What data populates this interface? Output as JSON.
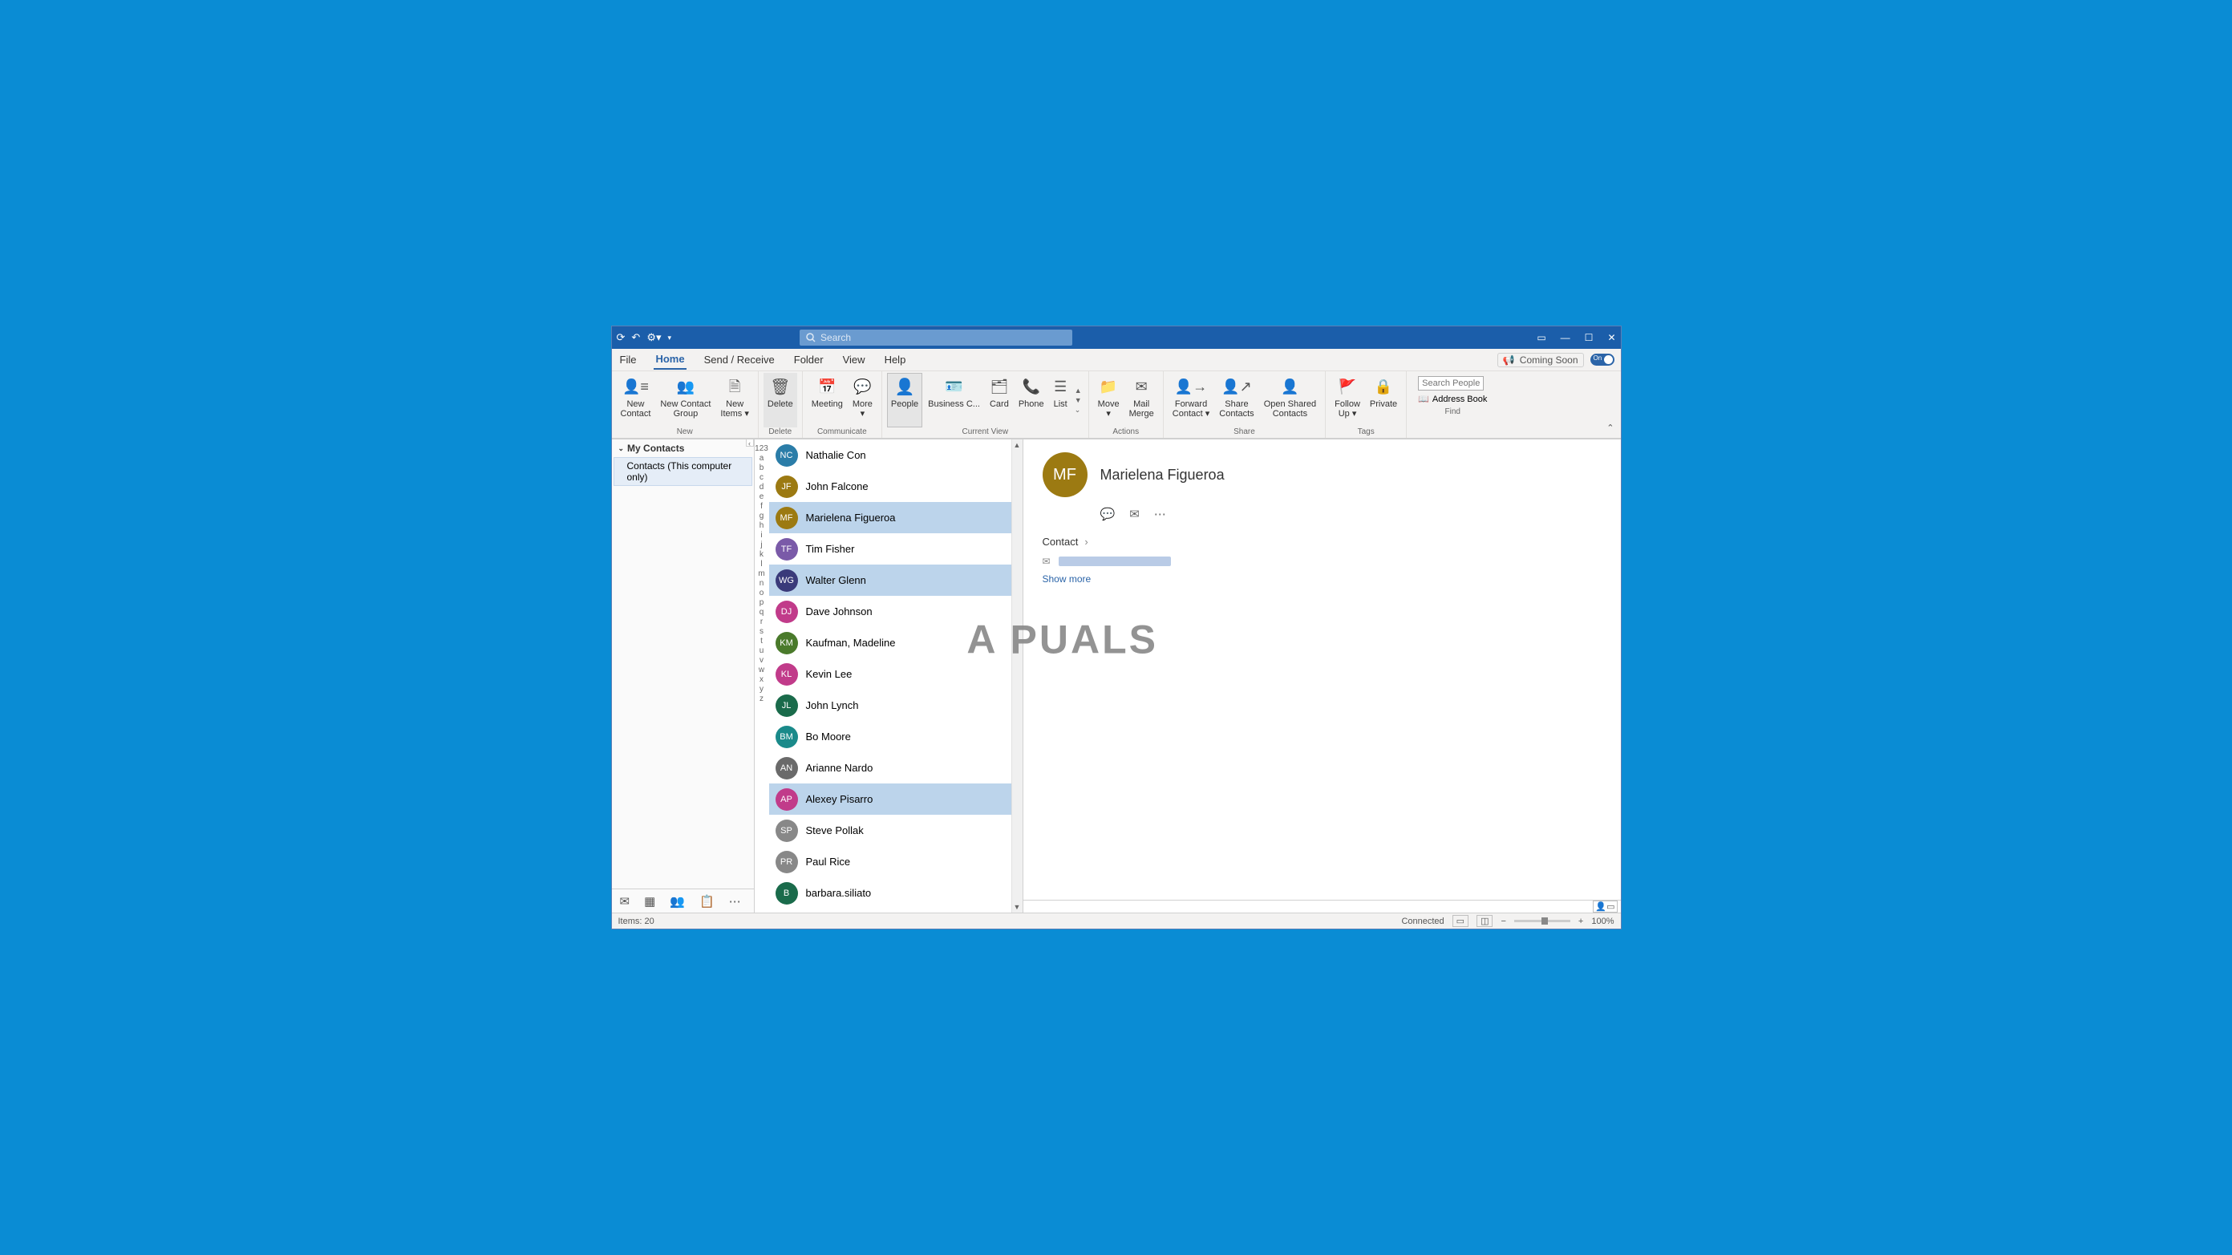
{
  "titlebar": {
    "search_placeholder": "Search"
  },
  "menubar": {
    "tabs": [
      "File",
      "Home",
      "Send / Receive",
      "Folder",
      "View",
      "Help"
    ],
    "active": "Home",
    "coming_soon": "Coming Soon",
    "toggle_state": "On"
  },
  "ribbon": {
    "groups": {
      "new": {
        "label": "New",
        "items": [
          {
            "label": "New\nContact",
            "icon": "person-plus"
          },
          {
            "label": "New Contact\nGroup",
            "icon": "people"
          },
          {
            "label": "New\nItems ▾",
            "icon": "file"
          }
        ]
      },
      "delete": {
        "label": "Delete",
        "items": [
          {
            "label": "Delete",
            "icon": "trash"
          }
        ]
      },
      "communicate": {
        "label": "Communicate",
        "items": [
          {
            "label": "Meeting",
            "icon": "calendar"
          },
          {
            "label": "More\n▾",
            "icon": "speech"
          }
        ]
      },
      "currentview": {
        "label": "Current View",
        "items": [
          {
            "label": "People",
            "icon": "person",
            "active": true
          },
          {
            "label": "Business C...",
            "icon": "card"
          },
          {
            "label": "Card",
            "icon": "card2"
          },
          {
            "label": "Phone",
            "icon": "phone"
          },
          {
            "label": "List",
            "icon": "list"
          }
        ]
      },
      "actions": {
        "label": "Actions",
        "items": [
          {
            "label": "Move\n▾",
            "icon": "move"
          },
          {
            "label": "Mail\nMerge",
            "icon": "envelope"
          }
        ]
      },
      "share": {
        "label": "Share",
        "items": [
          {
            "label": "Forward\nContact ▾",
            "icon": "forward"
          },
          {
            "label": "Share\nContacts",
            "icon": "share"
          },
          {
            "label": "Open Shared\nContacts",
            "icon": "openshared"
          }
        ]
      },
      "tags": {
        "label": "Tags",
        "items": [
          {
            "label": "Follow\nUp ▾",
            "icon": "flag"
          },
          {
            "label": "Private",
            "icon": "lock"
          }
        ]
      },
      "find": {
        "label": "Find",
        "search_placeholder": "Search People",
        "address_book": "Address Book"
      }
    }
  },
  "folderpane": {
    "heading": "My Contacts",
    "folder": "Contacts (This computer only)"
  },
  "az_index": [
    "123",
    "a",
    "b",
    "c",
    "d",
    "e",
    "f",
    "g",
    "h",
    "i",
    "j",
    "k",
    "l",
    "m",
    "n",
    "o",
    "p",
    "q",
    "r",
    "s",
    "t",
    "u",
    "v",
    "w",
    "x",
    "y",
    "z"
  ],
  "contacts": [
    {
      "initials": "NC",
      "name": "Nathalie Con",
      "color": "#2b7da8",
      "selected": false
    },
    {
      "initials": "JF",
      "name": "John Falcone",
      "color": "#9c7a12",
      "selected": false
    },
    {
      "initials": "MF",
      "name": "Marielena Figueroa",
      "color": "#9c7a12",
      "selected": true
    },
    {
      "initials": "TF",
      "name": "Tim Fisher",
      "color": "#7a5aa8",
      "selected": false
    },
    {
      "initials": "WG",
      "name": "Walter Glenn",
      "color": "#3a3a7a",
      "selected": true
    },
    {
      "initials": "DJ",
      "name": "Dave Johnson",
      "color": "#c13b8a",
      "selected": false
    },
    {
      "initials": "KM",
      "name": "Kaufman, Madeline",
      "color": "#4a7a2b",
      "selected": false
    },
    {
      "initials": "KL",
      "name": "Kevin Lee",
      "color": "#c13b8a",
      "selected": false
    },
    {
      "initials": "JL",
      "name": "John Lynch",
      "color": "#1a6b4b",
      "selected": false
    },
    {
      "initials": "BM",
      "name": "Bo Moore",
      "color": "#1a8a8a",
      "selected": false
    },
    {
      "initials": "AN",
      "name": "Arianne Nardo",
      "color": "#6a6a6a",
      "selected": false
    },
    {
      "initials": "AP",
      "name": "Alexey Pisarro",
      "color": "#c13b8a",
      "selected": true
    },
    {
      "initials": "SP",
      "name": "Steve Pollak",
      "color": "#888",
      "selected": false
    },
    {
      "initials": "PR",
      "name": "Paul Rice",
      "color": "#888",
      "selected": false
    },
    {
      "initials": "B",
      "name": "barbara.siliato",
      "color": "#1a6b4b",
      "selected": false
    }
  ],
  "preview": {
    "initials": "MF",
    "name": "Marielena Figueroa",
    "section": "Contact",
    "show_more": "Show more"
  },
  "statusbar": {
    "items": "Items: 20",
    "connected": "Connected",
    "zoom": "100%"
  },
  "watermark": "A  PUALS"
}
